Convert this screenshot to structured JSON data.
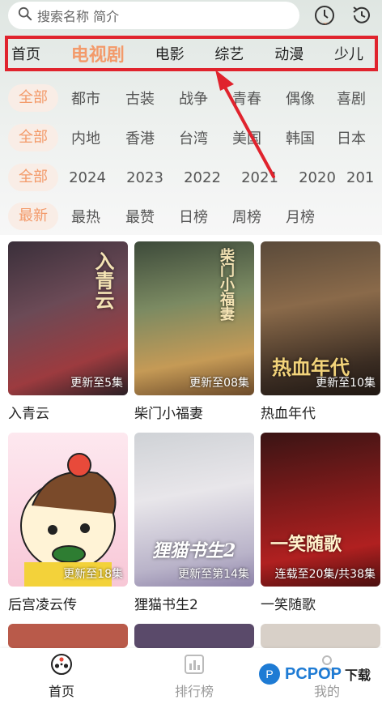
{
  "search": {
    "placeholder": "搜索名称 简介"
  },
  "icons": {
    "history": "history-icon",
    "refresh": "clock-rewind-icon",
    "search": "search-icon"
  },
  "categories": [
    {
      "label": "首页",
      "active": false
    },
    {
      "label": "电视剧",
      "active": true
    },
    {
      "label": "电影",
      "active": false
    },
    {
      "label": "综艺",
      "active": false
    },
    {
      "label": "动漫",
      "active": false
    },
    {
      "label": "少儿",
      "active": false
    }
  ],
  "filters": {
    "genre": [
      "全部",
      "都市",
      "古装",
      "战争",
      "青春",
      "偶像",
      "喜剧"
    ],
    "region": [
      "全部",
      "内地",
      "香港",
      "台湾",
      "美国",
      "韩国",
      "日本"
    ],
    "year": [
      "全部",
      "2024",
      "2023",
      "2022",
      "2021",
      "2020",
      "201"
    ],
    "sort": [
      "最新",
      "最热",
      "最赞",
      "日榜",
      "周榜",
      "月榜"
    ]
  },
  "shows": [
    {
      "title": "入青云",
      "badge": "更新至5集",
      "art": "入青云"
    },
    {
      "title": "柴门小福妻",
      "badge": "更新至08集",
      "art": "柴门小福妻"
    },
    {
      "title": "热血年代",
      "badge": "更新至10集",
      "art": "热血年代"
    },
    {
      "title": "后宫凌云传",
      "badge": "更新至18集",
      "art": ""
    },
    {
      "title": "狸猫书生2",
      "badge": "更新至第14集",
      "art": "狸猫书生2"
    },
    {
      "title": "一笑随歌",
      "badge": "连载至20集/共38集",
      "art": "一笑随歌"
    }
  ],
  "bottom_nav": [
    {
      "label": "首页",
      "active": true
    },
    {
      "label": "排行榜",
      "active": false
    },
    {
      "label": "我的",
      "active": false
    }
  ],
  "watermark": {
    "brand": "PCPOP",
    "suffix": "下载"
  },
  "colors": {
    "accent": "#f39a6a",
    "highlight_border": "#e0232d"
  }
}
